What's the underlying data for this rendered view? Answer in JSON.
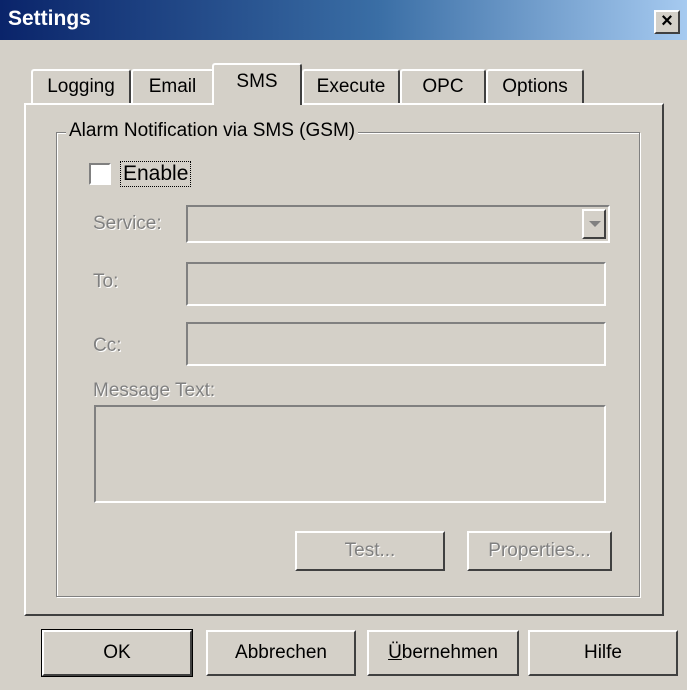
{
  "window": {
    "title": "Settings",
    "close_glyph": "×",
    "close_icon": "close-icon"
  },
  "tabs": [
    {
      "label": "Logging",
      "active": false
    },
    {
      "label": "Email",
      "active": false
    },
    {
      "label": "SMS",
      "active": true
    },
    {
      "label": "Execute",
      "active": false
    },
    {
      "label": "OPC",
      "active": false
    },
    {
      "label": "Options",
      "active": false
    }
  ],
  "sms": {
    "group_title": "Alarm Notification via SMS (GSM)",
    "enable_label": "Enable",
    "enable_checked": false,
    "service_label": "Service:",
    "service_value": "",
    "to_label": "To:",
    "to_value": "",
    "cc_label": "Cc:",
    "cc_value": "",
    "message_label": "Message Text:",
    "message_value": "",
    "test_button": "Test...",
    "properties_button": "Properties...",
    "dropdown_icon": "chevron-down-icon"
  },
  "footer": {
    "ok": "OK",
    "cancel": "Abbrechen",
    "apply_underlined": "Ü",
    "apply_rest": "bernehmen",
    "help": "Hilfe"
  },
  "colors": {
    "face": "#d4d0c8",
    "title_start": "#0a246a",
    "title_end": "#a6caf0",
    "disabled_text": "#808080"
  }
}
